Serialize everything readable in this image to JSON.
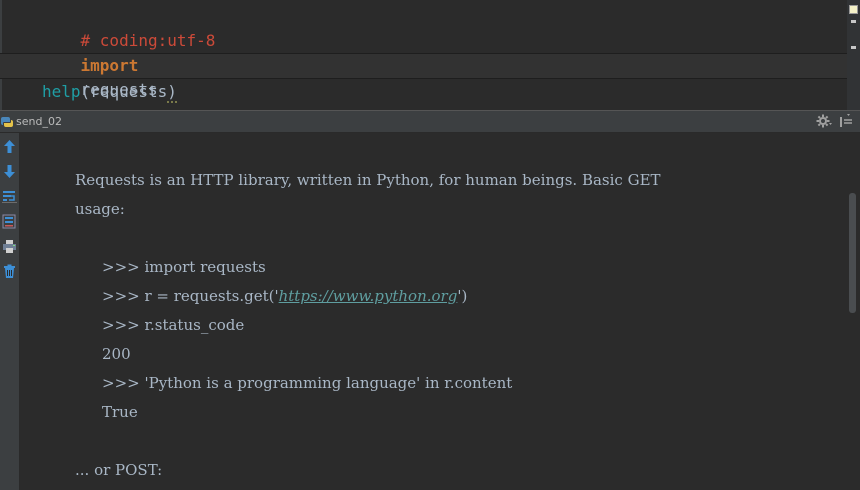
{
  "editor": {
    "lines": {
      "comment": "# coding:utf-8",
      "import_keyword": "import",
      "import_module": "requests",
      "call_func": "help",
      "call_open": "(",
      "call_arg": "requests",
      "call_close": ")"
    }
  },
  "run": {
    "tab_label": "send_02",
    "toolbar": {
      "up": "up-arrow-icon",
      "down": "down-arrow-icon",
      "wrap": "soft-wrap-icon",
      "scroll_end": "scroll-to-end-icon",
      "print": "print-icon",
      "clear": "trash-icon"
    },
    "output": {
      "line1": "Requests is an HTTP library, written in Python, for human beings. Basic GET",
      "line2": "usage:",
      "line3": ">>> import requests",
      "line4_prefix": ">>> r = requests.get('",
      "line4_link": "https://www.python.org",
      "line4_suffix": "')",
      "line5": ">>> r.status_code",
      "line6": "200",
      "line7": ">>> 'Python is a programming language' in r.content",
      "line8": "True",
      "line9": "... or POST:"
    }
  },
  "colors": {
    "editor_bg": "#2b2b2b",
    "comment": "#cc4a39",
    "keyword": "#cc7832",
    "builtin": "#1f9ea5",
    "console_text": "#a9b7c6",
    "link": "#5f9ea0"
  }
}
